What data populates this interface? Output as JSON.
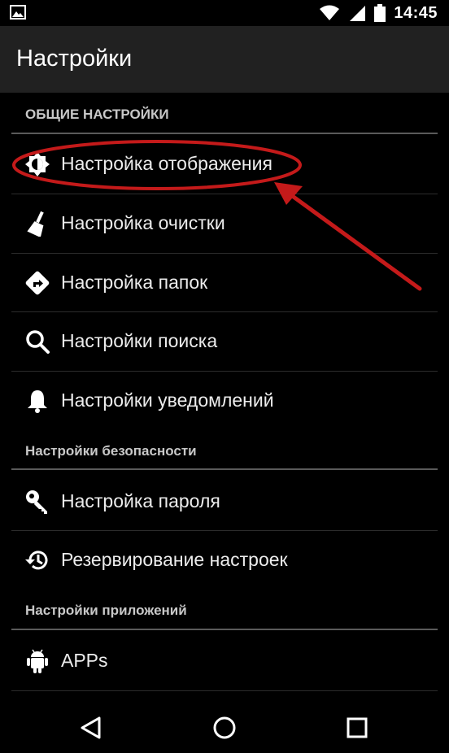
{
  "status_bar": {
    "time": "14:45"
  },
  "app_bar": {
    "title": "Настройки"
  },
  "sections": [
    {
      "header": "ОБЩИЕ НАСТРОЙКИ",
      "items": [
        {
          "label": "Настройка отображения",
          "icon": "brightness-icon"
        },
        {
          "label": "Настройка очистки",
          "icon": "broom-icon"
        },
        {
          "label": "Настройка папок",
          "icon": "directions-icon"
        },
        {
          "label": "Настройки поиска",
          "icon": "search-icon"
        },
        {
          "label": "Настройки уведомлений",
          "icon": "bell-icon"
        }
      ]
    },
    {
      "header": "Настройки безопасности",
      "items": [
        {
          "label": "Настройка пароля",
          "icon": "key-icon"
        },
        {
          "label": "Резервирование настроек",
          "icon": "history-icon"
        }
      ]
    },
    {
      "header": "Настройки приложений",
      "items": [
        {
          "label": "APPs",
          "icon": "android-icon"
        }
      ]
    }
  ],
  "annotation": {
    "highlight_color": "#c41a1a",
    "highlighted_item": "Настройка отображения"
  }
}
